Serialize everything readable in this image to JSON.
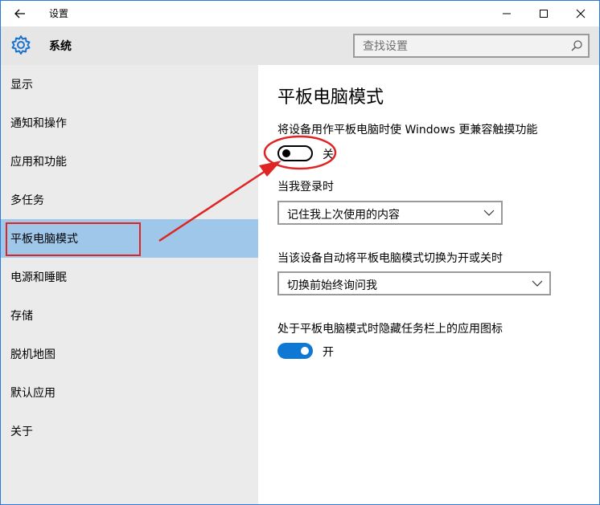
{
  "window": {
    "title": "设置",
    "back_icon": "back-arrow-icon",
    "controls": [
      "minimize-icon",
      "maximize-icon",
      "close-icon"
    ]
  },
  "header": {
    "icon": "gear-icon",
    "title": "系统",
    "search": {
      "placeholder": "查找设置",
      "icon": "search-icon"
    }
  },
  "sidebar": {
    "items": [
      {
        "label": "显示"
      },
      {
        "label": "通知和操作"
      },
      {
        "label": "应用和功能"
      },
      {
        "label": "多任务"
      },
      {
        "label": "平板电脑模式",
        "selected": true
      },
      {
        "label": "电源和睡眠"
      },
      {
        "label": "存储"
      },
      {
        "label": "脱机地图"
      },
      {
        "label": "默认应用"
      },
      {
        "label": "关于"
      }
    ]
  },
  "main": {
    "title": "平板电脑模式",
    "touch_setting": {
      "label": "将设备用作平板电脑时使 Windows 更兼容触摸功能",
      "state": "关",
      "on": false
    },
    "signin_setting": {
      "label": "当我登录时",
      "value": "记住我上次使用的内容"
    },
    "switch_setting": {
      "label": "当该设备自动将平板电脑模式切换为开或关时",
      "value": "切换前始终询问我"
    },
    "hide_icons_setting": {
      "label": "处于平板电脑模式时隐藏任务栏上的应用图标",
      "state": "开",
      "on": true
    }
  },
  "colors": {
    "accent": "#0f78d4",
    "selected_nav": "#9ec7ea",
    "sidebar_bg": "#ebebeb",
    "annotation": "#e02424"
  }
}
